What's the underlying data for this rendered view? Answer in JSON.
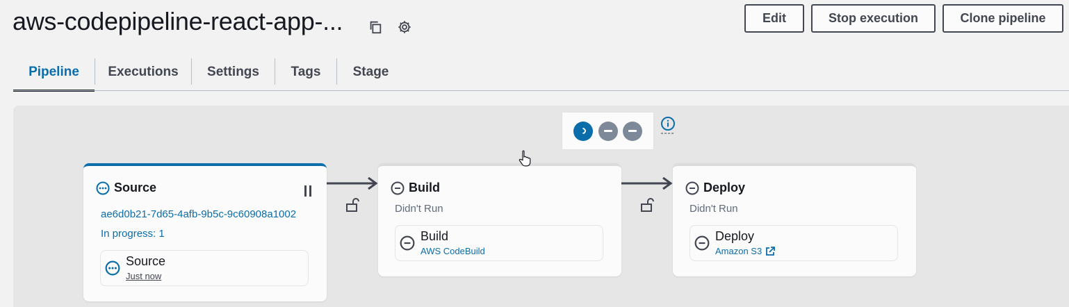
{
  "header": {
    "title": "aws-codepipeline-react-app-...",
    "copy_icon": "copy-icon",
    "settings_icon": "gear-icon"
  },
  "actions": {
    "edit_label": "Edit",
    "stop_label": "Stop execution",
    "clone_label": "Clone pipeline"
  },
  "tabs": [
    {
      "label": "Pipeline",
      "active": true
    },
    {
      "label": "Executions",
      "active": false
    },
    {
      "label": "Settings",
      "active": false
    },
    {
      "label": "Tags",
      "active": false
    },
    {
      "label": "Stage",
      "active": false
    }
  ],
  "legend": {
    "states": [
      "in-progress",
      "not-run",
      "not-run"
    ],
    "info_icon": "info-icon"
  },
  "stages": [
    {
      "name": "Source",
      "status_icon": "in-progress-icon",
      "commit_id": "ae6d0b21-7d65-4afb-9b5c-9c60908a1002",
      "progress_text": "In progress: 1",
      "action": {
        "name": "Source",
        "subtext": "Just now",
        "status_icon": "in-progress-icon"
      }
    },
    {
      "name": "Build",
      "status_icon": "not-run-icon",
      "status_text": "Didn't Run",
      "action": {
        "name": "Build",
        "provider": "AWS CodeBuild",
        "status_icon": "not-run-icon"
      }
    },
    {
      "name": "Deploy",
      "status_icon": "not-run-icon",
      "status_text": "Didn't Run",
      "action": {
        "name": "Deploy",
        "provider": "Amazon S3",
        "status_icon": "not-run-icon",
        "external_link_icon": "external-link-icon"
      }
    }
  ],
  "transitions": [
    {
      "icon": "unlock-icon"
    },
    {
      "icon": "unlock-icon"
    }
  ],
  "colors": {
    "accent": "#0b6daa",
    "in_progress": "#0b6daa",
    "not_run": "#7d8998"
  }
}
